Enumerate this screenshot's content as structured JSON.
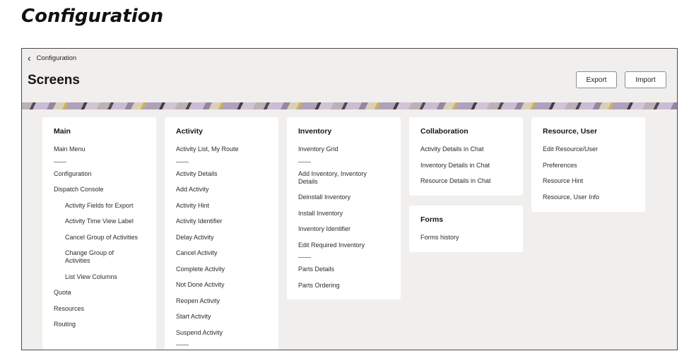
{
  "doc_title": "Configuration",
  "breadcrumb": {
    "back_icon": "chevron-left-icon",
    "label": "Configuration"
  },
  "page": {
    "title": "Screens"
  },
  "toolbar": {
    "export_label": "Export",
    "import_label": "Import"
  },
  "cards": {
    "main": {
      "title": "Main",
      "items": [
        "Main Menu",
        "Configuration",
        "Dispatch Console",
        "Activity Fields for Export",
        "Activity Time View Label",
        "Cancel Group of Activities",
        "Change Group of Activities",
        "List View Columns",
        "Quota",
        "Resources",
        "Routing"
      ]
    },
    "activity": {
      "title": "Activity",
      "items": [
        "Activity List, My Route",
        "Activity Details",
        "Add Activity",
        "Activity Hint",
        "Activity Identifier",
        "Delay Activity",
        "Cancel Activity",
        "Complete Activity",
        "Not Done Activity",
        "Reopen Activity",
        "Start Activity",
        "Suspend Activity"
      ]
    },
    "inventory": {
      "title": "Inventory",
      "items": [
        "Inventory Grid",
        "Add Inventory, Inventory Details",
        "Deinstall Inventory",
        "Install Inventory",
        "Inventory Identifier",
        "Edit Required Inventory",
        "Parts Details",
        "Parts Ordering"
      ]
    },
    "collaboration": {
      "title": "Collaboration",
      "items": [
        "Activity Details in Chat",
        "Inventory Details in Chat",
        "Resource Details in Chat"
      ]
    },
    "forms": {
      "title": "Forms",
      "items": [
        "Forms history"
      ]
    },
    "resource_user": {
      "title": "Resource, User",
      "items": [
        "Edit Resource/User",
        "Preferences",
        "Resource Hint",
        "Resource, User Info"
      ]
    }
  }
}
